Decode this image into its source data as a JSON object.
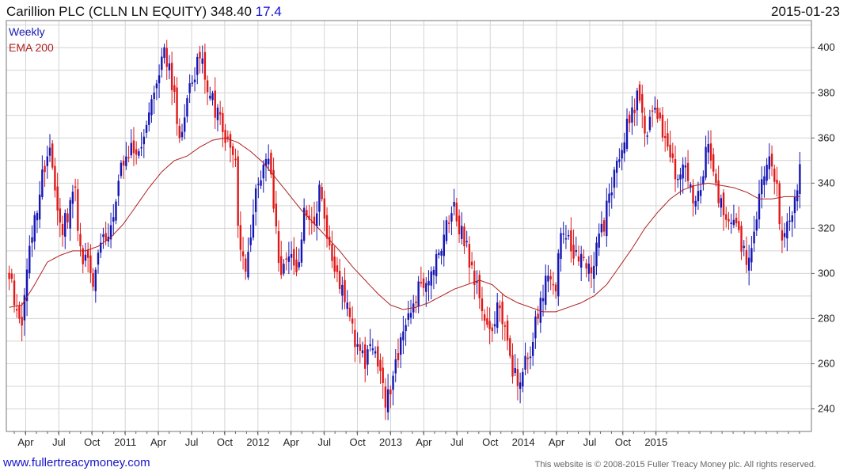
{
  "header": {
    "title": "Carillion PLC (CLLN LN EQUITY)",
    "price": "348.40",
    "change": "17.4",
    "date": "2015-01-23"
  },
  "legend": {
    "weekly": "Weekly",
    "ema": "EMA 200"
  },
  "footer": {
    "url": "www.fullertreacymoney.com",
    "copyright": "This website is © 2008-2015 Fuller Treacy Money plc. All rights reserved."
  },
  "colors": {
    "up": "#1515b4",
    "down": "#e01818",
    "ema": "#b02020",
    "grid": "#d4d4d4",
    "axis": "#666666"
  },
  "chart_data": {
    "type": "candlestick",
    "title": "Carillion PLC (CLLN LN EQUITY)",
    "frequency": "weekly",
    "ylim": [
      230,
      412
    ],
    "y_ticks": [
      240,
      260,
      280,
      300,
      320,
      340,
      360,
      380,
      400
    ],
    "x_ticks": [
      "Apr",
      "Jul",
      "Oct",
      "2011",
      "Apr",
      "Jul",
      "Oct",
      "2012",
      "Apr",
      "Jul",
      "Oct",
      "2013",
      "Apr",
      "Jul",
      "Oct",
      "2014",
      "Apr",
      "Jul",
      "Oct",
      "2015"
    ],
    "price_anchors": [
      [
        0,
        298
      ],
      [
        3,
        285
      ],
      [
        5,
        280
      ],
      [
        9,
        318
      ],
      [
        13,
        343
      ],
      [
        16,
        358
      ],
      [
        18,
        338
      ],
      [
        21,
        320
      ],
      [
        26,
        335
      ],
      [
        28,
        310
      ],
      [
        33,
        298
      ],
      [
        36,
        318
      ],
      [
        40,
        318
      ],
      [
        44,
        345
      ],
      [
        48,
        355
      ],
      [
        52,
        352
      ],
      [
        55,
        375
      ],
      [
        58,
        388
      ],
      [
        61,
        398
      ],
      [
        64,
        385
      ],
      [
        67,
        360
      ],
      [
        70,
        380
      ],
      [
        75,
        395
      ],
      [
        79,
        380
      ],
      [
        82,
        370
      ],
      [
        85,
        362
      ],
      [
        89,
        350
      ],
      [
        90,
        320
      ],
      [
        93,
        300
      ],
      [
        96,
        330
      ],
      [
        99,
        340
      ],
      [
        102,
        352
      ],
      [
        104,
        330
      ],
      [
        107,
        295
      ],
      [
        110,
        310
      ],
      [
        113,
        300
      ],
      [
        116,
        325
      ],
      [
        119,
        320
      ],
      [
        122,
        335
      ],
      [
        126,
        310
      ],
      [
        130,
        295
      ],
      [
        134,
        285
      ],
      [
        137,
        265
      ],
      [
        140,
        262
      ],
      [
        143,
        270
      ],
      [
        146,
        255
      ],
      [
        148,
        242
      ],
      [
        151,
        255
      ],
      [
        154,
        268
      ],
      [
        157,
        280
      ],
      [
        160,
        290
      ],
      [
        163,
        298
      ],
      [
        166,
        302
      ],
      [
        169,
        310
      ],
      [
        172,
        320
      ],
      [
        175,
        330
      ],
      [
        177,
        320
      ],
      [
        180,
        310
      ],
      [
        183,
        298
      ],
      [
        186,
        285
      ],
      [
        189,
        275
      ],
      [
        192,
        285
      ],
      [
        195,
        280
      ],
      [
        198,
        258
      ],
      [
        200,
        250
      ],
      [
        203,
        262
      ],
      [
        206,
        270
      ],
      [
        209,
        290
      ],
      [
        212,
        298
      ],
      [
        215,
        295
      ],
      [
        217,
        320
      ],
      [
        219,
        315
      ],
      [
        222,
        310
      ],
      [
        225,
        305
      ],
      [
        228,
        300
      ],
      [
        231,
        310
      ],
      [
        234,
        322
      ],
      [
        237,
        340
      ],
      [
        240,
        355
      ],
      [
        243,
        365
      ],
      [
        246,
        375
      ],
      [
        248,
        380
      ],
      [
        250,
        360
      ],
      [
        253,
        375
      ],
      [
        256,
        365
      ],
      [
        259,
        360
      ],
      [
        262,
        345
      ],
      [
        264,
        340
      ],
      [
        266,
        352
      ],
      [
        269,
        332
      ],
      [
        272,
        340
      ],
      [
        275,
        360
      ],
      [
        278,
        338
      ],
      [
        281,
        328
      ],
      [
        284,
        325
      ],
      [
        287,
        315
      ],
      [
        290,
        305
      ],
      [
        293,
        320
      ],
      [
        296,
        338
      ],
      [
        299,
        352
      ],
      [
        302,
        340
      ],
      [
        304,
        312
      ],
      [
        306,
        322
      ],
      [
        309,
        331
      ],
      [
        311,
        348
      ]
    ],
    "last_close": 348.4,
    "ema_200_anchors": [
      [
        0,
        285
      ],
      [
        5,
        286
      ],
      [
        10,
        295
      ],
      [
        15,
        305
      ],
      [
        20,
        308
      ],
      [
        25,
        310
      ],
      [
        30,
        310
      ],
      [
        35,
        312
      ],
      [
        40,
        316
      ],
      [
        45,
        322
      ],
      [
        50,
        330
      ],
      [
        55,
        338
      ],
      [
        60,
        345
      ],
      [
        65,
        350
      ],
      [
        70,
        352
      ],
      [
        75,
        356
      ],
      [
        80,
        359
      ],
      [
        85,
        360
      ],
      [
        90,
        358
      ],
      [
        95,
        354
      ],
      [
        100,
        349
      ],
      [
        105,
        342
      ],
      [
        110,
        335
      ],
      [
        115,
        328
      ],
      [
        120,
        322
      ],
      [
        125,
        316
      ],
      [
        130,
        310
      ],
      [
        135,
        303
      ],
      [
        140,
        297
      ],
      [
        145,
        291
      ],
      [
        150,
        286
      ],
      [
        155,
        284
      ],
      [
        160,
        285
      ],
      [
        165,
        287
      ],
      [
        170,
        290
      ],
      [
        175,
        293
      ],
      [
        180,
        295
      ],
      [
        185,
        297
      ],
      [
        190,
        295
      ],
      [
        195,
        290
      ],
      [
        200,
        287
      ],
      [
        205,
        285
      ],
      [
        210,
        283
      ],
      [
        215,
        283
      ],
      [
        220,
        285
      ],
      [
        225,
        287
      ],
      [
        230,
        290
      ],
      [
        235,
        295
      ],
      [
        240,
        303
      ],
      [
        245,
        311
      ],
      [
        250,
        320
      ],
      [
        255,
        327
      ],
      [
        260,
        333
      ],
      [
        265,
        337
      ],
      [
        270,
        339
      ],
      [
        275,
        340
      ],
      [
        280,
        339
      ],
      [
        285,
        338
      ],
      [
        290,
        336
      ],
      [
        295,
        333
      ],
      [
        300,
        333
      ],
      [
        305,
        334
      ],
      [
        311,
        334
      ]
    ]
  }
}
